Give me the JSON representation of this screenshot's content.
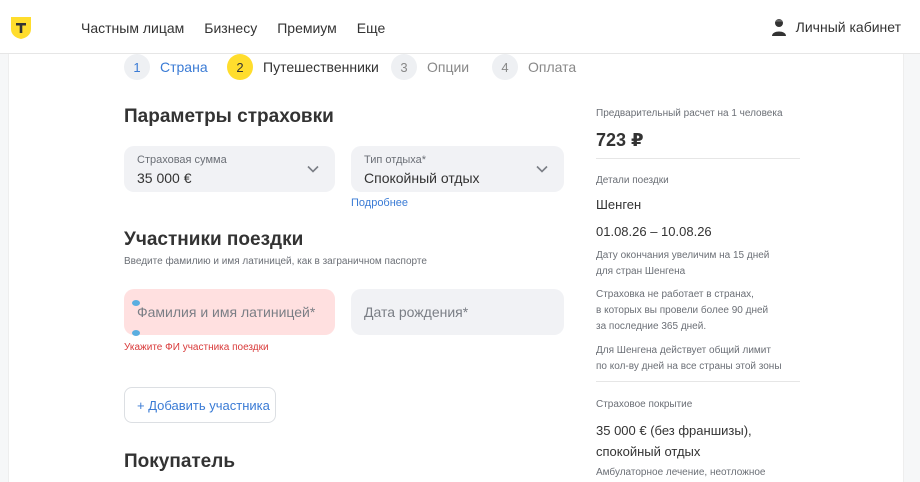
{
  "header": {
    "nav": [
      "Частным лицам",
      "Бизнесу",
      "Премиум",
      "Еще"
    ],
    "account_label": "Личный кабинет",
    "brand_color": "#ffdd2d"
  },
  "stepper": [
    {
      "num": "1",
      "label": "Страна",
      "state": "done"
    },
    {
      "num": "2",
      "label": "Путешественники",
      "state": "active"
    },
    {
      "num": "3",
      "label": "Опции",
      "state": "future"
    },
    {
      "num": "4",
      "label": "Оплата",
      "state": "future"
    }
  ],
  "params": {
    "title": "Параметры страховки",
    "sum_label": "Страховая сумма",
    "sum_value": "35 000 €",
    "type_label": "Тип отдыха*",
    "type_value": "Спокойный отдых",
    "more_link": "Подробнее"
  },
  "participants": {
    "title": "Участники поездки",
    "hint": "Введите фамилию и имя латиницей, как в заграничном паспорте",
    "name_placeholder": "Фамилия и имя латиницей*",
    "dob_placeholder": "Дата рождения*",
    "error": "Укажите ФИ участника поездки",
    "add_button": "+ Добавить участника"
  },
  "buyer": {
    "title": "Покупатель"
  },
  "sidebar": {
    "estimate_label": "Предварительный расчет на 1 человека",
    "price": "723 ₽",
    "details_label": "Детали поездки",
    "destination": "Шенген",
    "dates": "01.08.26 – 10.08.26",
    "note1": [
      "Дату окончания увеличим на 15 дней",
      "для стран Шенгена"
    ],
    "note2": [
      "Страховка не работает в странах,",
      "в которых вы провели более 90 дней",
      "за последние 365 дней."
    ],
    "note3": [
      "Для Шенгена действует общий лимит",
      "по кол-ву дней на все страны этой зоны"
    ],
    "coverage_label": "Страховое покрытие",
    "coverage_value": [
      "35 000 € (без франшизы),",
      "спокойный отдых"
    ],
    "coverage_more": "Амбулаторное лечение, неотложное"
  }
}
